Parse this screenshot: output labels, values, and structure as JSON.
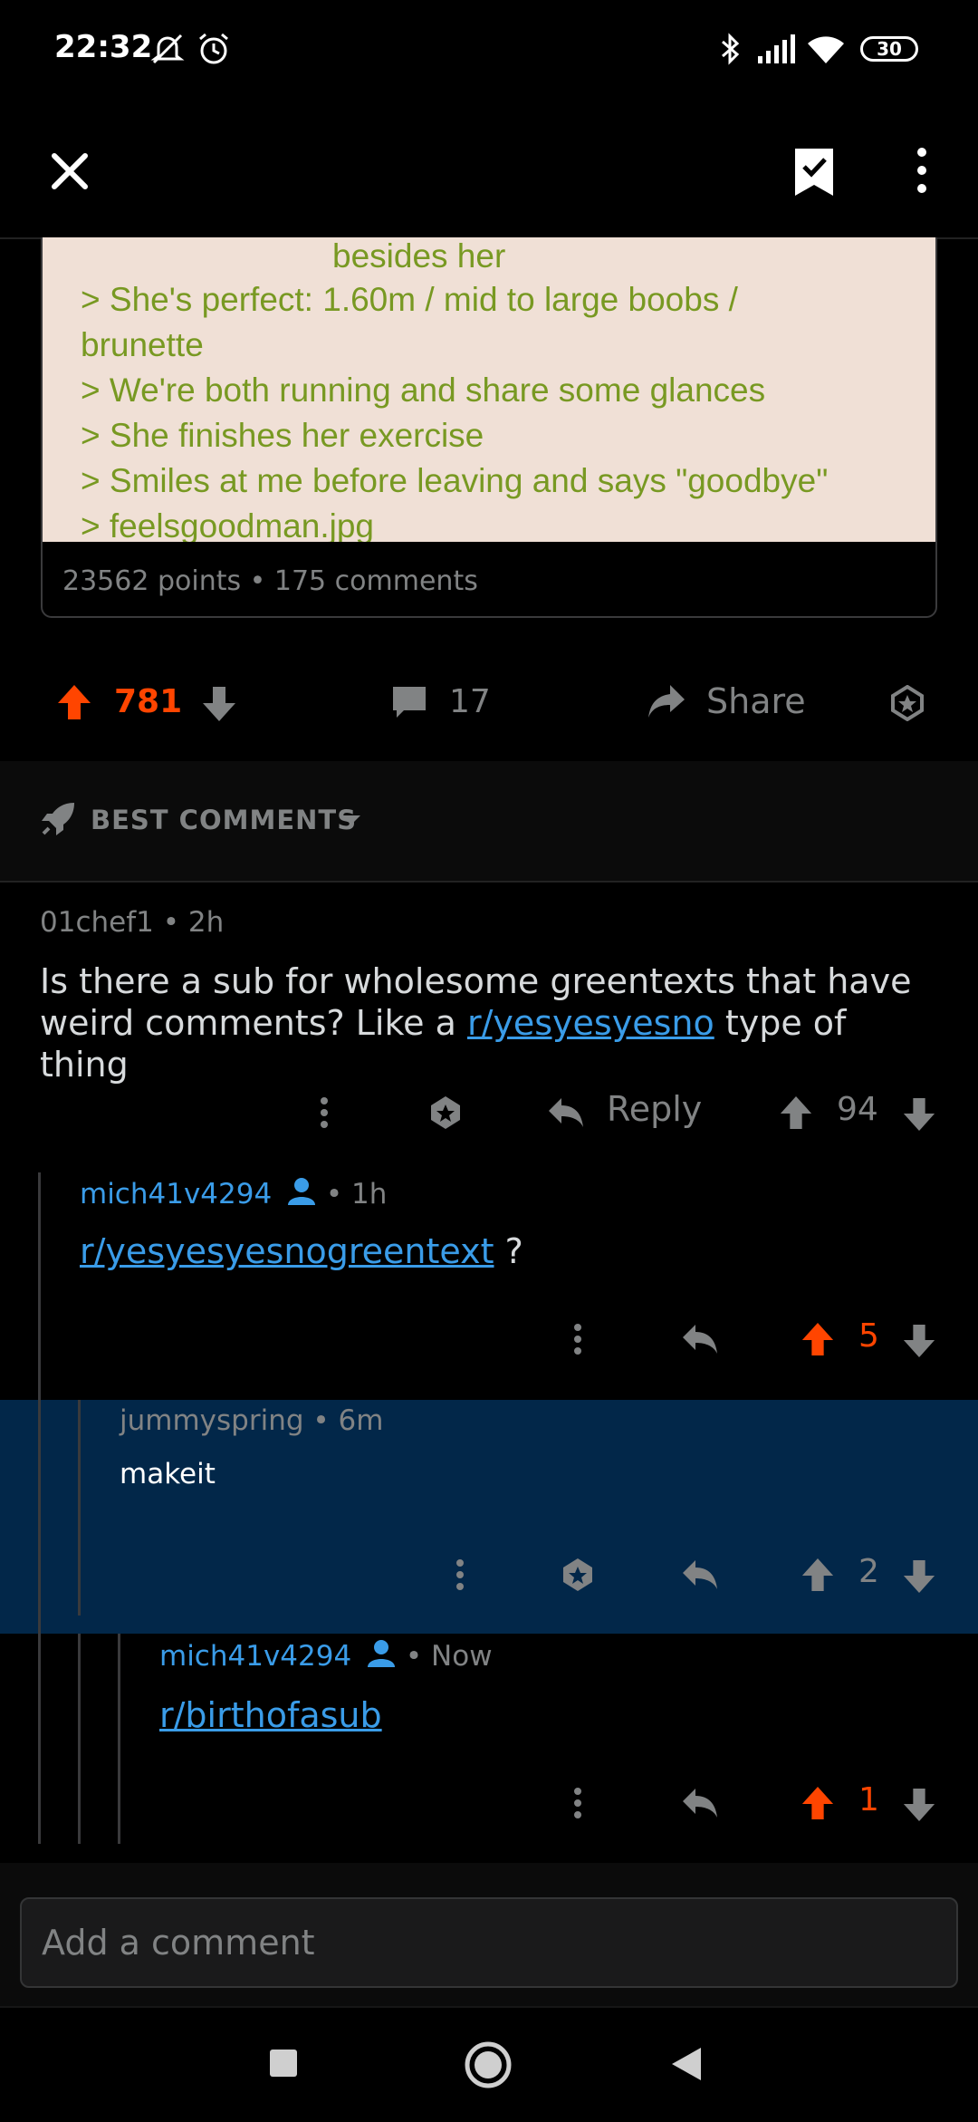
{
  "status_bar": {
    "time": "22:32",
    "battery": "30"
  },
  "post": {
    "greentext_lines": [
      "besides her",
      "> She's perfect: 1.60m / mid to large boobs /",
      "brunette",
      "> We're both running and share some glances",
      "> She finishes her exercise",
      "> Smiles at me before leaving and says \"goodbye\"",
      "> feelsgoodman.jpg"
    ],
    "stats": "23562 points • 175 comments"
  },
  "actions": {
    "upvotes": "781",
    "comments": "17",
    "share_label": "Share"
  },
  "sort": {
    "label": "BEST COMMENTS"
  },
  "comments": [
    {
      "author": "01chef1",
      "time": "• 2h",
      "body_before": "Is there a sub for wholesome greentexts that have weird comments? Like a ",
      "body_link": "r/yesyesyesno",
      "body_after": " type of thing",
      "reply_label": "Reply",
      "score": "94"
    },
    {
      "author": "mich41v4294",
      "time": "• 1h",
      "body_link": "r/yesyesyesnogreentext",
      "body_after": " ?",
      "score": "5"
    },
    {
      "author": "jummyspring",
      "time": "• 6m",
      "body": "makeit",
      "score": "2"
    },
    {
      "author": "mich41v4294",
      "time": "• Now",
      "body_link": "r/birthofasub",
      "score": "1"
    }
  ],
  "composer": {
    "placeholder": "Add a comment"
  },
  "colors": {
    "upvote": "#ff4500",
    "link": "#3a9ce8",
    "greentext": "#789922",
    "highlight": "#022749"
  }
}
